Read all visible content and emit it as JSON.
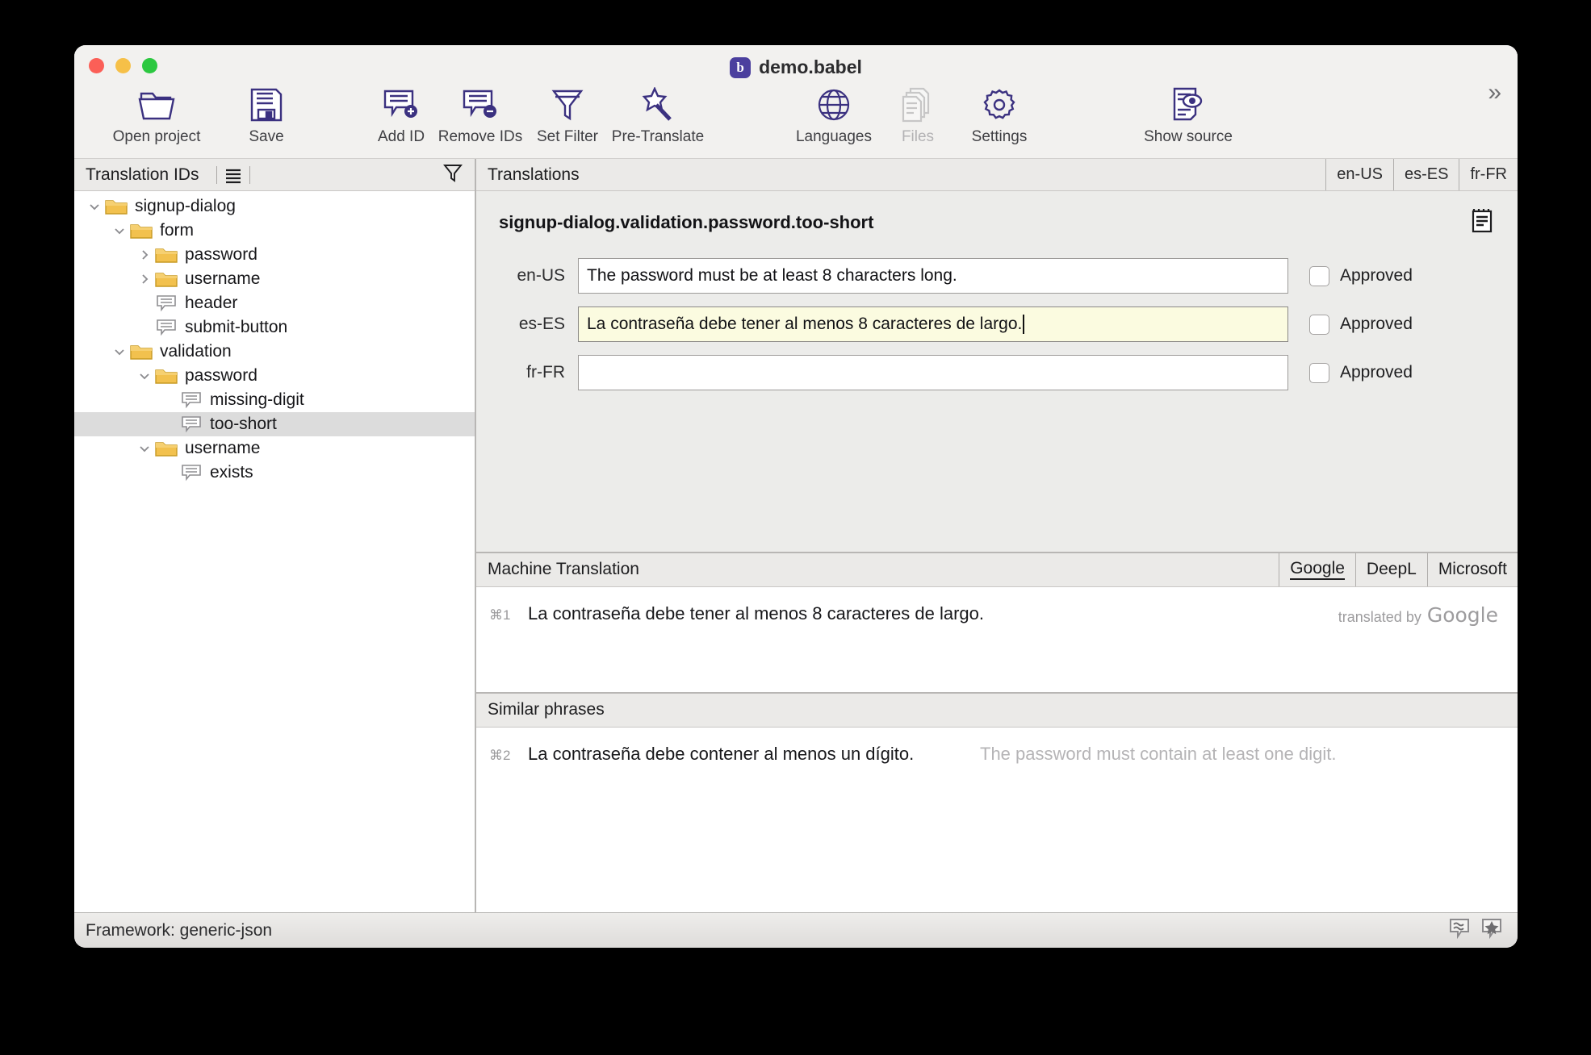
{
  "window": {
    "title": "demo.babel",
    "app_badge_letter": "b",
    "traffic_lights": [
      "close",
      "minimize",
      "zoom"
    ]
  },
  "toolbar": {
    "items": [
      {
        "label": "Open project",
        "icon": "open-folder-icon",
        "enabled": true
      },
      {
        "label": "Save",
        "icon": "floppy-disk-icon",
        "enabled": true
      },
      {
        "label": "Add ID",
        "icon": "speech-bubble-plus-icon",
        "enabled": true
      },
      {
        "label": "Remove IDs",
        "icon": "speech-bubble-minus-icon",
        "enabled": true
      },
      {
        "label": "Set Filter",
        "icon": "funnel-icon",
        "enabled": true
      },
      {
        "label": "Pre-Translate",
        "icon": "magic-wand-icon",
        "enabled": true
      },
      {
        "label": "Languages",
        "icon": "globe-icon",
        "enabled": true
      },
      {
        "label": "Files",
        "icon": "documents-icon",
        "enabled": false
      },
      {
        "label": "Settings",
        "icon": "gear-icon",
        "enabled": true
      },
      {
        "label": "Show source",
        "icon": "document-eye-icon",
        "enabled": true
      }
    ],
    "overflow_label": "»"
  },
  "sidebar": {
    "title": "Translation IDs",
    "list_icon": "list-lines-icon",
    "filter_icon": "funnel-icon",
    "tree": [
      {
        "label": "signup-dialog",
        "depth": 0,
        "type": "folder",
        "twisty": "down",
        "selected": false
      },
      {
        "label": "form",
        "depth": 1,
        "type": "folder",
        "twisty": "down",
        "selected": false
      },
      {
        "label": "password",
        "depth": 2,
        "type": "folder",
        "twisty": "right",
        "selected": false
      },
      {
        "label": "username",
        "depth": 2,
        "type": "folder",
        "twisty": "right",
        "selected": false
      },
      {
        "label": "header",
        "depth": 2,
        "type": "string",
        "twisty": "none",
        "selected": false
      },
      {
        "label": "submit-button",
        "depth": 2,
        "type": "string",
        "twisty": "none",
        "selected": false
      },
      {
        "label": "validation",
        "depth": 1,
        "type": "folder",
        "twisty": "down",
        "selected": false
      },
      {
        "label": "password",
        "depth": 2,
        "type": "folder",
        "twisty": "down",
        "selected": false
      },
      {
        "label": "missing-digit",
        "depth": 3,
        "type": "string",
        "twisty": "none",
        "selected": false
      },
      {
        "label": "too-short",
        "depth": 3,
        "type": "string",
        "twisty": "none",
        "selected": true
      },
      {
        "label": "username",
        "depth": 2,
        "type": "folder",
        "twisty": "down",
        "selected": false
      },
      {
        "label": "exists",
        "depth": 3,
        "type": "string",
        "twisty": "none",
        "selected": false
      }
    ]
  },
  "translations": {
    "title": "Translations",
    "lang_tabs": [
      "en-US",
      "es-ES",
      "fr-FR"
    ],
    "key": "signup-dialog.validation.password.too-short",
    "notes_icon": "notepad-icon",
    "rows": [
      {
        "lang": "en-US",
        "value": "The password must be at least 8 characters long.",
        "focused": false,
        "approved": false,
        "approved_label": "Approved"
      },
      {
        "lang": "es-ES",
        "value": "La contraseña debe tener al menos 8 caracteres de largo.",
        "focused": true,
        "approved": false,
        "approved_label": "Approved"
      },
      {
        "lang": "fr-FR",
        "value": "",
        "focused": false,
        "approved": false,
        "approved_label": "Approved"
      }
    ]
  },
  "machine_translation": {
    "title": "Machine Translation",
    "providers": [
      {
        "label": "Google",
        "active": true
      },
      {
        "label": "DeepL",
        "active": false
      },
      {
        "label": "Microsoft",
        "active": false
      }
    ],
    "suggestions": [
      {
        "shortcut": "⌘1",
        "text": "La contraseña debe tener al menos 8 caracteres de largo.",
        "attribution_prefix": "translated by",
        "attribution_provider": "Google"
      }
    ]
  },
  "similar_phrases": {
    "title": "Similar phrases",
    "rows": [
      {
        "shortcut": "⌘2",
        "source": "La contraseña debe contener al menos un dígito.",
        "english": "The password must contain at least one digit."
      }
    ]
  },
  "status_bar": {
    "text": "Framework: generic-json",
    "icons": [
      "similar-phrases-icon",
      "favorite-star-icon"
    ]
  },
  "colors": {
    "accent": "#3b3180",
    "window_bg": "#f2f1ef",
    "panel_bg": "#ececea",
    "header_bg": "#ebeae8",
    "selection": "#dcdcdc",
    "focused_field": "#fbfbe0",
    "folder": "#f2c14e",
    "disabled_text": "#b3b2b4"
  }
}
